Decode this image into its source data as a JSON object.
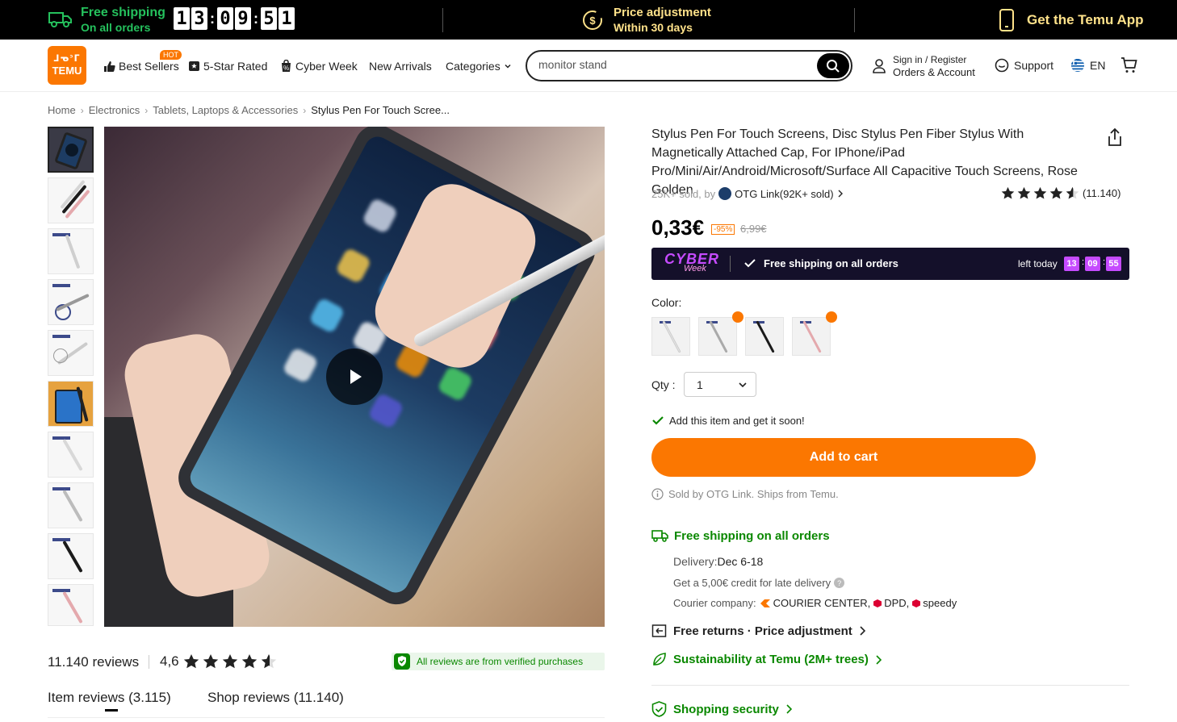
{
  "promo": {
    "shipping_title": "Free shipping",
    "shipping_sub": "On all orders",
    "timer_digits": [
      "1",
      "3",
      "0",
      "9",
      "5",
      "1"
    ],
    "price_title": "Price adjustment",
    "price_sub": "Within 30 days",
    "app_text": "Get the Temu App"
  },
  "header": {
    "logo_top": "ᒧᓀᐣᒥ",
    "logo_bottom": "TEMU",
    "nav": [
      {
        "label": "Best Sellers",
        "icon": "thumbs-up-icon"
      },
      {
        "label": "5-Star Rated",
        "icon": "star-badge-icon"
      },
      {
        "label": "Cyber Week",
        "icon": "percent-bag-icon"
      },
      {
        "label": "New Arrivals"
      },
      {
        "label": "Categories",
        "icon": "chevron-down-icon"
      }
    ],
    "hot_badge": "HOT",
    "search_value": "monitor stand",
    "sign_in": "Sign in / Register",
    "orders": "Orders & Account",
    "support": "Support",
    "lang": "EN"
  },
  "breadcrumb": [
    "Home",
    "Electronics",
    "Tablets, Laptops & Accessories",
    "Stylus Pen For Touch Scree..."
  ],
  "product": {
    "title": "Stylus Pen For Touch Screens, Disc Stylus Pen Fiber Stylus With Magnetically Attached Cap, For IPhone/iPad Pro/Mini/Air/Android/Microsoft/Surface All Capacitive Touch Screens, Rose Golden",
    "sold": "25K+ sold, by",
    "seller": "OTG Link(92K+ sold)",
    "rating_count": "(11.140)",
    "price": "0,33€",
    "discount": "-95%",
    "old_price": "6,99€",
    "cyber_word": "CYBER",
    "cyber_sub": "Week",
    "cyber_shipping": "Free shipping on all orders",
    "left_today": "left today",
    "left_timer": [
      "13",
      "09",
      "55"
    ],
    "color_label": "Color:",
    "swatches": [
      {
        "color": "#e6e6e6",
        "hot": false
      },
      {
        "color": "#cfcfcf",
        "hot": true
      },
      {
        "color": "#1b1b1b",
        "hot": false
      },
      {
        "color": "#e4a9ad",
        "hot": true
      }
    ],
    "qty_label": "Qty :",
    "qty_value": "1",
    "soon": "Add this item and get it soon!",
    "add_to_cart": "Add to cart",
    "sold_by": "Sold by OTG Link. Ships from Temu.",
    "free_shipping": "Free shipping on all orders",
    "delivery_label": "Delivery:",
    "delivery_date": "Dec 6-18",
    "credit": "Get a 5,00€ credit for late delivery",
    "courier_label": "Courier company:",
    "couriers": [
      "COURIER CENTER,",
      "DPD,",
      "speedy"
    ],
    "returns": "Free returns · Price adjustment",
    "sustainability": "Sustainability at Temu (2M+ trees)",
    "security": "Shopping security"
  },
  "reviews": {
    "count": "11.140 reviews",
    "score": "4,6",
    "verified": "All reviews are from verified purchases",
    "tab_item": "Item reviews (3.115)",
    "tab_shop": "Shop reviews (11.140)"
  },
  "colors": {
    "accent": "#fb7701",
    "green": "#0a8800",
    "promo_green": "#25c15d",
    "promo_yellow": "#ffe28a",
    "cyber_bg": "#14102a",
    "cyber_purple": "#c64bff"
  }
}
